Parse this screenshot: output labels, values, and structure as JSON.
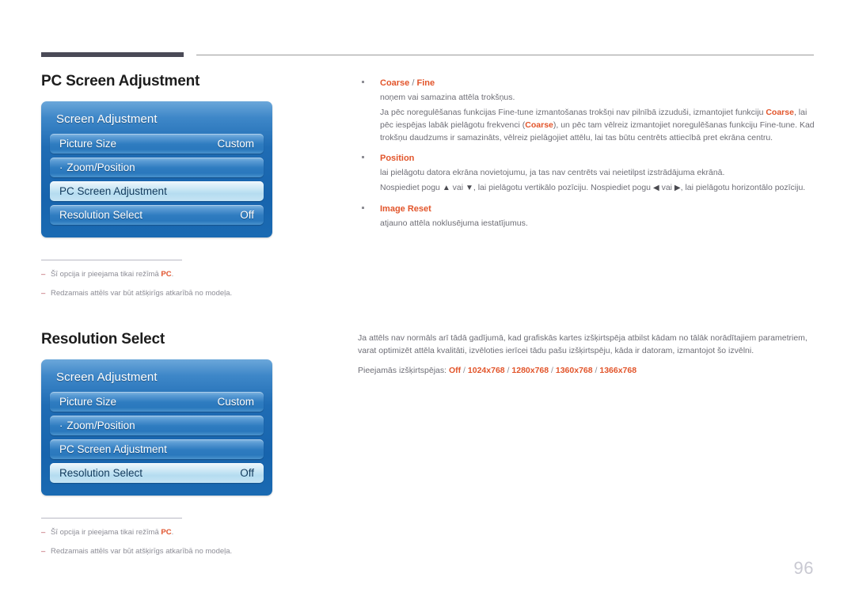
{
  "page": {
    "number": "96"
  },
  "sections": [
    {
      "title": "PC Screen Adjustment",
      "osd": {
        "title": "Screen Adjustment",
        "rows": [
          {
            "label": "Picture Size",
            "value": "Custom",
            "dot": "",
            "selected": false
          },
          {
            "label": "Zoom/Position",
            "value": "",
            "dot": "·",
            "selected": false
          },
          {
            "label": "PC Screen Adjustment",
            "value": "",
            "dot": "",
            "selected": true
          },
          {
            "label": "Resolution Select",
            "value": "Off",
            "dot": "",
            "selected": false
          }
        ]
      },
      "notes": [
        {
          "dash": "–",
          "text_before": "Šī opcija ir pieejama tikai režīmā ",
          "bold": "PC",
          "text_after": "."
        },
        {
          "dash": "–",
          "text_before": "Redzamais attēls var būt atšķirīgs atkarībā no modeļa.",
          "bold": "",
          "text_after": ""
        }
      ]
    },
    {
      "title": "Resolution Select",
      "osd": {
        "title": "Screen Adjustment",
        "rows": [
          {
            "label": "Picture Size",
            "value": "Custom",
            "dot": "",
            "selected": false
          },
          {
            "label": "Zoom/Position",
            "value": "",
            "dot": "·",
            "selected": false
          },
          {
            "label": "PC Screen Adjustment",
            "value": "",
            "dot": "",
            "selected": false
          },
          {
            "label": "Resolution Select",
            "value": "Off",
            "dot": "",
            "selected": true
          }
        ]
      },
      "notes": [
        {
          "dash": "–",
          "text_before": "Šī opcija ir pieejama tikai režīmā ",
          "bold": "PC",
          "text_after": "."
        },
        {
          "dash": "–",
          "text_before": "Redzamais attēls var būt atšķirīgs atkarībā no modeļa.",
          "bold": "",
          "text_after": ""
        }
      ]
    }
  ],
  "right_top": {
    "bullets": [
      {
        "head_main": "Coarse",
        "head_sep": " / ",
        "head_second": "Fine",
        "paras": [
          "noņem vai samazina attēla trokšņus."
        ],
        "rich_para_1": {
          "p1": "Ja pēc noregulēšanas funkcijas Fine-tune izmantošanas trokšņi nav pilnībā izzuduši, izmantojiet funkciju ",
          "b1": "Coarse",
          "p2": ", lai pēc iespējas labāk pielāgotu frekvenci (",
          "b2": "Coarse",
          "p3": "), un pēc tam vēlreiz izmantojiet noregulēšanas funkciju Fine-tune. Kad trokšņu daudzums ir samazināts, vēlreiz pielāgojiet attēlu, lai tas būtu centrēts attiecībā pret ekrāna centru."
        }
      },
      {
        "head_main": "Position",
        "head_sep": "",
        "head_second": "",
        "paras": [
          "lai pielāgotu datora ekrāna novietojumu, ja tas nav centrēts vai neietilpst izstrādājuma ekrānā."
        ],
        "arrow_para": {
          "p1": "Nospiediet pogu ",
          "a1": "▲",
          "p2": " vai ",
          "a2": "▼",
          "p3": ", lai pielāgotu vertikālo pozīciju. Nospiediet pogu ",
          "a3": "◀",
          "p4": " vai ",
          "a4": "▶",
          "p5": ", lai pielāgotu horizontālo pozīciju."
        }
      },
      {
        "head_main": "Image Reset",
        "head_sep": "",
        "head_second": "",
        "paras": [
          "atjauno attēla noklusējuma iestatījumus."
        ]
      }
    ]
  },
  "right_bottom": {
    "intro": "Ja attēls nav normāls arī tādā gadījumā, kad grafiskās kartes izšķirtspēja atbilst kādam no tālāk norādītajiem parametriem, varat optimizēt attēla kvalitāti, izvēloties ierīcei tādu pašu izšķirtspēju, kāda ir datoram, izmantojot šo izvēlni.",
    "list_label": "Pieejamās izšķirtspējas: ",
    "resolutions": [
      "Off",
      "1024x768",
      "1280x768",
      "1360x768",
      "1366x768"
    ],
    "separator": " / "
  },
  "colors": {
    "accent_orange": "#e2552b",
    "panel_blue": "#1f6cb4",
    "highlight_blue": "#b5dcf0",
    "rule_dark": "#4a4a57"
  }
}
